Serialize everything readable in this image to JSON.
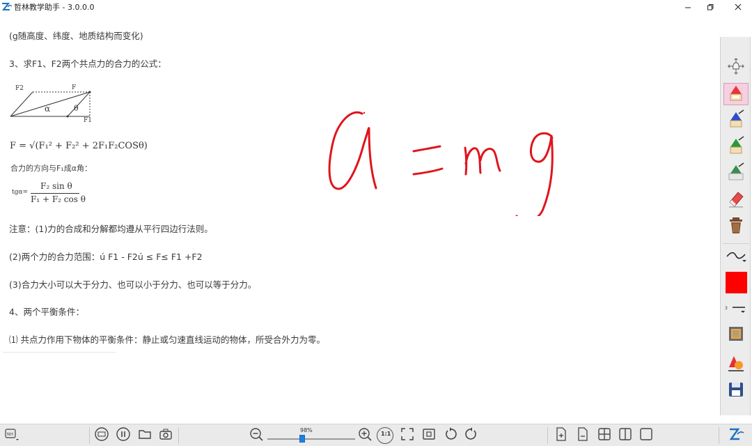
{
  "window": {
    "title": "哲林教学助手 - 3.0.0.0",
    "logo_icon": "zhelin-logo-icon"
  },
  "document": {
    "lines": [
      "(g随高度、纬度、地质结构而变化)",
      "3、求F1、F2两个共点力的合力的公式：",
      "注意：(1)力的合成和分解都均遵从平行四边行法则。",
      "(2)两个力的合力范围：ú F1 - F2ú ≤ F≤ F1 +F2",
      "(3)合力大小可以大于分力、也可以小于分力、也可以等于分力。",
      "4、两个平衡条件：",
      "⑴ 共点力作用下物体的平衡条件：静止或匀速直线运动的物体，所受合外力为零。"
    ],
    "figure": {
      "labels": {
        "f2": "F2",
        "f": "F",
        "alpha": "α",
        "theta": "θ",
        "f1": "F1"
      },
      "formula_main": "F = √(F₁² + F₂² + 2F₁F₂COSθ)",
      "direction_note": "合力的方向与F₁成α角：",
      "tan_prefix": "tgα=",
      "tan_numerator": "F₂ sin θ",
      "tan_denominator": "F₁ + F₂ cos θ"
    }
  },
  "handwriting": {
    "color": "#e0141c",
    "description_icon": "ink-stroke"
  },
  "toolbar": {
    "tools": [
      {
        "name": "pan-tool",
        "icon": "hand-move-icon"
      },
      {
        "name": "pen-tool-red",
        "icon": "pen-red-icon",
        "active": true
      },
      {
        "name": "pen-tool-blue",
        "icon": "pen-blue-icon"
      },
      {
        "name": "pen-tool-green",
        "icon": "pen-green-icon"
      },
      {
        "name": "highlighter-tool",
        "icon": "highlighter-icon"
      },
      {
        "name": "eraser-tool",
        "icon": "eraser-icon"
      },
      {
        "name": "clear-tool",
        "icon": "trash-icon"
      }
    ],
    "current_color": "#ff0000",
    "stroke_size": "3"
  },
  "bottom": {
    "zoom_percent": "98%",
    "zoom_fraction": 0.4,
    "one_to_one": "1:1"
  },
  "colors": {
    "accent": "#1f7fe0",
    "panel": "#ececec",
    "active_tool": "#f7cfe0"
  }
}
